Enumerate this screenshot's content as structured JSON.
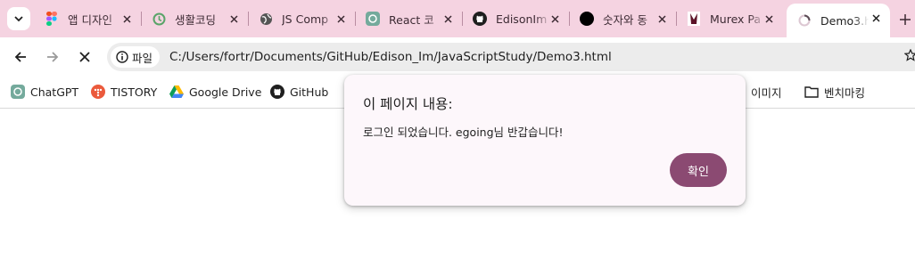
{
  "colors": {
    "tabstrip_bg": "#f5d3e1",
    "dialog_bg": "#fdf7fb",
    "confirm_button": "#8b4a72"
  },
  "tabs": [
    {
      "title": "앱 디자인",
      "icon": "figma-icon"
    },
    {
      "title": "생활코딩",
      "icon": "opentutorials-icon"
    },
    {
      "title": "JS Comp",
      "icon": "globe-icon"
    },
    {
      "title": "React 코",
      "icon": "chatgpt-icon"
    },
    {
      "title": "EdisonIm",
      "icon": "github-icon"
    },
    {
      "title": "숫자와 동",
      "icon": "black-circle-icon"
    },
    {
      "title": "Murex Pa",
      "icon": "murex-icon"
    },
    {
      "title": "Demo3.h",
      "icon": "loading-icon",
      "active": true
    }
  ],
  "toolbar": {
    "site_chip": "파일",
    "url": "C:/Users/fortr/Documents/GitHub/Edison_Im/JavaScriptStudy/Demo3.html"
  },
  "bookmarks": [
    {
      "label": "ChatGPT",
      "icon": "chatgpt-icon"
    },
    {
      "label": "TISTORY",
      "icon": "tistory-icon"
    },
    {
      "label": "Google Drive",
      "icon": "google-drive-icon"
    },
    {
      "label": "GitHub",
      "icon": "github-icon"
    },
    {
      "label": "이미지",
      "icon": "folder-icon"
    },
    {
      "label": "벤치마킹",
      "icon": "folder-icon"
    }
  ],
  "dialog": {
    "title": "이 페이지 내용:",
    "message": "로그인 되었습니다. egoing님 반갑습니다!",
    "confirm": "확인"
  }
}
